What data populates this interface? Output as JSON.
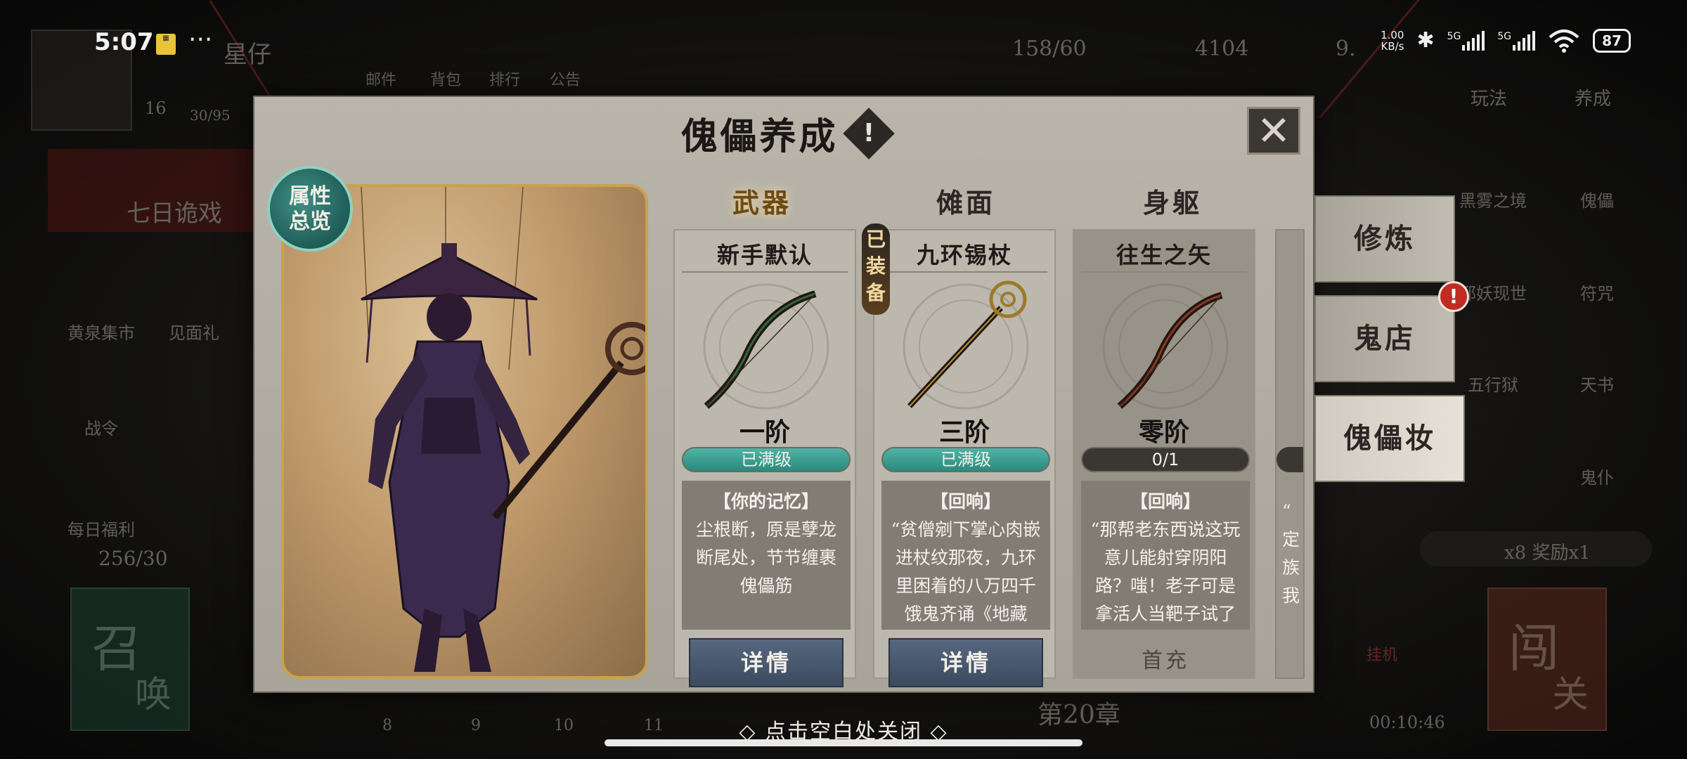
{
  "status_bar": {
    "time": "5:07",
    "net_speed_value": "1.00",
    "net_speed_unit": "KB/s",
    "signal1": "5G",
    "signal2": "5G",
    "battery": "87"
  },
  "background": {
    "player_tag": "星仔",
    "level": "16",
    "exp": "30/95",
    "top_menu": [
      "邮件",
      "背包",
      "排行",
      "公告"
    ],
    "currency": [
      {
        "name": "stamina",
        "value": "158/60"
      },
      {
        "name": "gold",
        "value": "4104"
      },
      {
        "name": "jade",
        "value": "9."
      }
    ],
    "banner_text": "七日诡戏",
    "left_icons": [
      "黄泉集市",
      "见面礼",
      "战令",
      "每日福利"
    ],
    "bag_count": "256/30",
    "summon_big": "召",
    "summon_small": "唤",
    "right_tabs": [
      "玩法",
      "养成"
    ],
    "right_icons": [
      "黑雾之境",
      "傀儡",
      "邪妖现世",
      "符咒",
      "五行狱",
      "天书",
      "鬼仆"
    ],
    "reward": "x8 奖励x1",
    "chapter": "第20章",
    "chapter_nums": [
      "8",
      "9",
      "10",
      "11"
    ],
    "idle_label": "挂机",
    "idle_timer": "00:10:46",
    "fight_big": "闯",
    "fight_small": "关"
  },
  "modal": {
    "title": "傀儡养成",
    "info_icon": "!",
    "close_icon": "✕",
    "attr_badge_line1": "属性",
    "attr_badge_line2": "总览",
    "tabs": [
      {
        "label": "武器",
        "active": true
      },
      {
        "label": "傩面",
        "active": false
      },
      {
        "label": "身躯",
        "active": false
      }
    ],
    "equipped_badge": "已装备",
    "cards": [
      {
        "name": "新手默认",
        "tier": "一阶",
        "level": "已满级",
        "desc_title": "【你的记忆】",
        "desc_text": "尘根断，原是孽龙断尾处，节节缠裹傀儡筋",
        "button": "详情",
        "weapon_type": "bow"
      },
      {
        "name": "九环锡杖",
        "tier": "三阶",
        "level": "已满级",
        "desc_title": "【回响】",
        "desc_text": "“贫僧剜下掌心肉嵌进杖纹那夜，九环里困着的八万四千饿鬼齐诵《地藏",
        "button": "详情",
        "weapon_type": "staff"
      },
      {
        "name": "往生之矢",
        "tier": "零阶",
        "level": "0/1",
        "desc_title": "【回响】",
        "desc_text": "“那帮老东西说这玩意儿能射穿阴阳路？嗤！老子可是拿活人当靶子试了",
        "button": "首充",
        "weapon_type": "bow"
      }
    ],
    "partial_card_chars": [
      "“",
      "定",
      "族",
      "我"
    ]
  },
  "side_panels": [
    "修炼",
    "鬼店",
    "傀儡妆"
  ],
  "side_alert": "!",
  "close_hint": "点击空白处关闭",
  "colors": {
    "accent_teal": "#2b8a7d",
    "gold_frame": "#c8a24d",
    "button_blue": "#3c4a5e"
  }
}
